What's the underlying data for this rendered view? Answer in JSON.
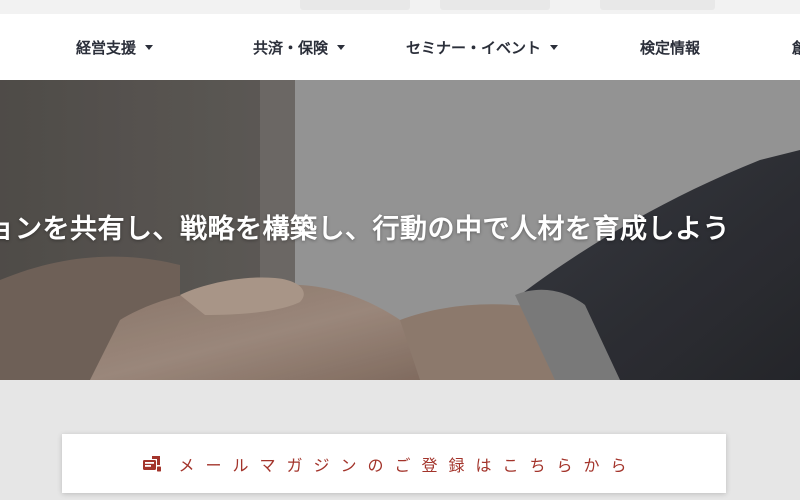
{
  "nav": {
    "items": [
      {
        "label": "経営支援",
        "has_dropdown": true
      },
      {
        "label": "共済・保険",
        "has_dropdown": true
      },
      {
        "label": "セミナー・イベント",
        "has_dropdown": true
      },
      {
        "label": "検定情報",
        "has_dropdown": false
      },
      {
        "label": "創",
        "has_dropdown": false
      }
    ]
  },
  "hero": {
    "tagline": "ジョンを共有し、戦略を構築し、行動の中で人材を育成しよう"
  },
  "newsletter": {
    "label": "メールマガジンのご登録はこちらから",
    "icon": "mail-icon",
    "accent_color": "#a3342b"
  }
}
